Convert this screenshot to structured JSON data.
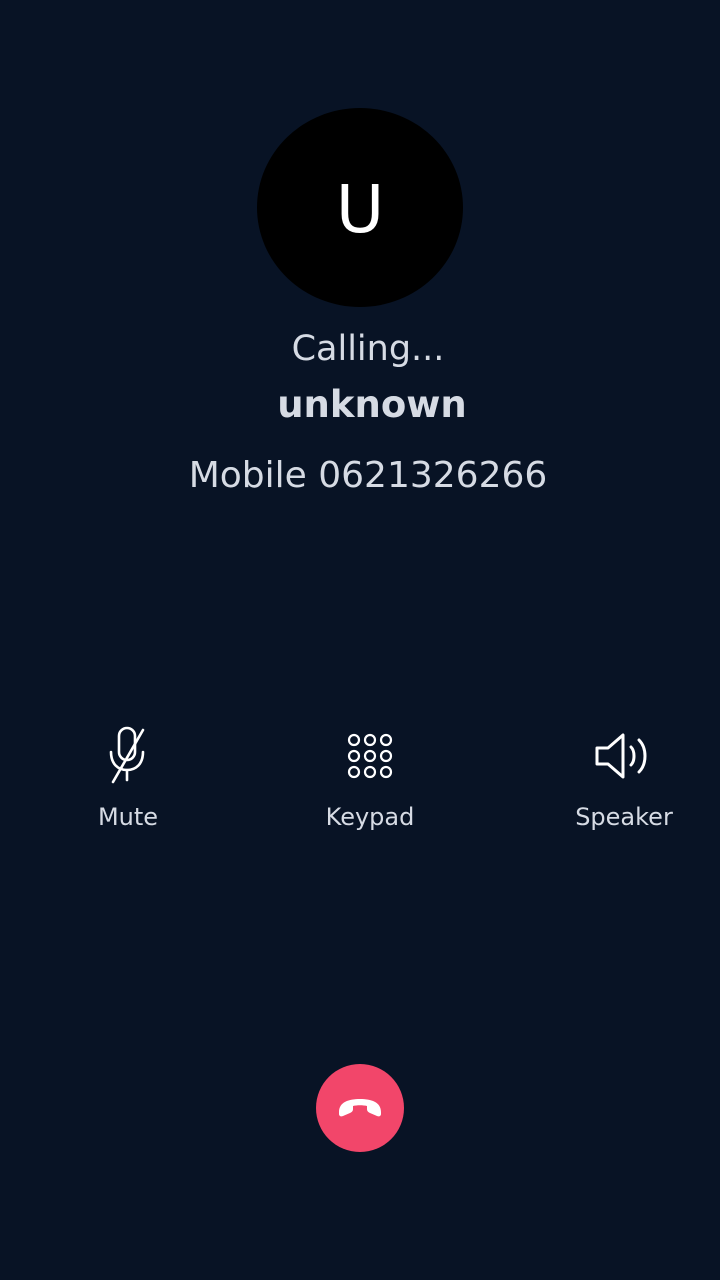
{
  "call": {
    "avatar_initial": "U",
    "status": "Calling...",
    "caller_name": "unknown",
    "caller_number": "Mobile 0621326266"
  },
  "actions": [
    {
      "id": "mute",
      "label": "Mute",
      "icon": "microphone-off-icon"
    },
    {
      "id": "keypad",
      "label": "Keypad",
      "icon": "dialpad-icon"
    },
    {
      "id": "speaker",
      "label": "Speaker",
      "icon": "speaker-icon"
    }
  ],
  "end_call": {
    "icon": "phone-hangup-icon",
    "color": "#f2466a"
  },
  "theme": {
    "background": "#081325",
    "avatar_background": "#000000",
    "text": "#d6dbe4"
  }
}
